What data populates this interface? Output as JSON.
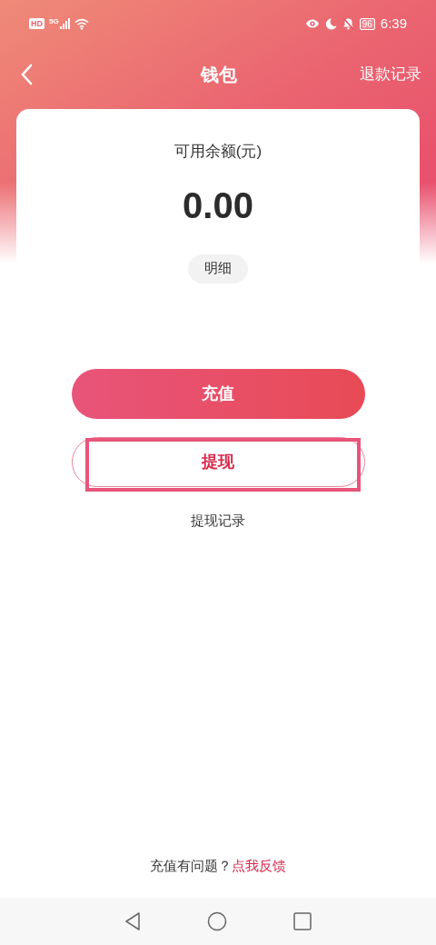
{
  "status_bar": {
    "hd": "HD",
    "network": "5G",
    "battery": "96",
    "time": "6:39"
  },
  "header": {
    "title": "钱包",
    "action": "退款记录"
  },
  "balance": {
    "label": "可用余额(元)",
    "amount": "0.00",
    "detail_button": "明细"
  },
  "buttons": [
    {
      "label": "充值",
      "kind": "filled",
      "highlighted": false
    },
    {
      "label": "提现",
      "kind": "outline",
      "highlighted": true
    }
  ],
  "withdraw_history_link": "提现记录",
  "footer": {
    "question": "充值有问题？",
    "link": "点我反馈"
  }
}
